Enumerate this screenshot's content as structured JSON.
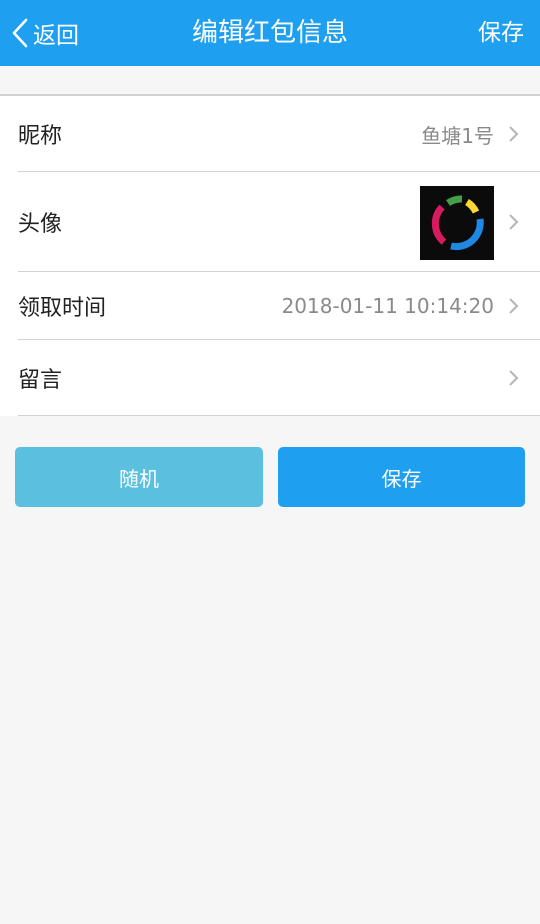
{
  "header": {
    "back_label": "返回",
    "title": "编辑红包信息",
    "save_label": "保存"
  },
  "rows": {
    "nickname": {
      "label": "昵称",
      "value": "鱼塘1号"
    },
    "avatar": {
      "label": "头像"
    },
    "claim_time": {
      "label": "领取时间",
      "value": "2018-01-11 10:14:20"
    },
    "message": {
      "label": "留言",
      "value": ""
    }
  },
  "buttons": {
    "random_label": "随机",
    "save_label": "保存"
  },
  "colors": {
    "header_bg": "#1f9ff0",
    "random_button": "#5bbfdf",
    "save_button": "#1f9ff0",
    "page_bg": "#f6f6f6"
  }
}
